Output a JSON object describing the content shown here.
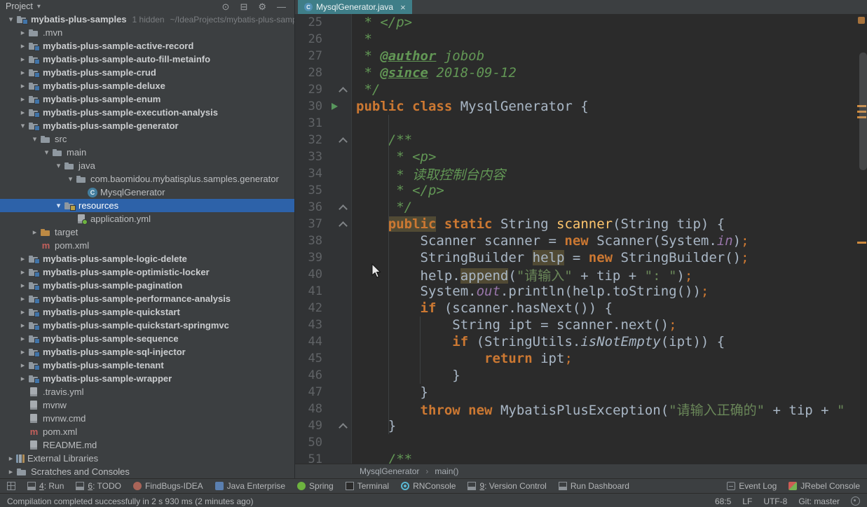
{
  "project_panel": {
    "title": "Project",
    "header_icons": [
      {
        "name": "locate-file-icon",
        "glyph": "⊙"
      },
      {
        "name": "collapse-all-icon",
        "glyph": "⊟"
      },
      {
        "name": "settings-icon",
        "glyph": "⚙"
      },
      {
        "name": "hide-panel-icon",
        "glyph": "—"
      }
    ],
    "tree": [
      {
        "label": "mybatis-plus-samples",
        "level": 0,
        "arrow": "down",
        "icon": "module",
        "bold": true,
        "meta": "1 hidden",
        "path": "~/IdeaProjects/mybatis-plus-samples"
      },
      {
        "label": ".mvn",
        "level": 1,
        "arrow": "right",
        "icon": "folder"
      },
      {
        "label": "mybatis-plus-sample-active-record",
        "level": 1,
        "arrow": "right",
        "icon": "module",
        "bold": true
      },
      {
        "label": "mybatis-plus-sample-auto-fill-metainfo",
        "level": 1,
        "arrow": "right",
        "icon": "module",
        "bold": true
      },
      {
        "label": "mybatis-plus-sample-crud",
        "level": 1,
        "arrow": "right",
        "icon": "module",
        "bold": true
      },
      {
        "label": "mybatis-plus-sample-deluxe",
        "level": 1,
        "arrow": "right",
        "icon": "module",
        "bold": true
      },
      {
        "label": "mybatis-plus-sample-enum",
        "level": 1,
        "arrow": "right",
        "icon": "module",
        "bold": true
      },
      {
        "label": "mybatis-plus-sample-execution-analysis",
        "level": 1,
        "arrow": "right",
        "icon": "module",
        "bold": true
      },
      {
        "label": "mybatis-plus-sample-generator",
        "level": 1,
        "arrow": "down",
        "icon": "module",
        "bold": true
      },
      {
        "label": "src",
        "level": 2,
        "arrow": "down",
        "icon": "folder"
      },
      {
        "label": "main",
        "level": 3,
        "arrow": "down",
        "icon": "folder"
      },
      {
        "label": "java",
        "level": 4,
        "arrow": "down",
        "icon": "folder"
      },
      {
        "label": "com.baomidou.mybatisplus.samples.generator",
        "level": 5,
        "arrow": "down",
        "icon": "package"
      },
      {
        "label": "MysqlGenerator",
        "level": 6,
        "arrow": "none",
        "icon": "class"
      },
      {
        "label": "resources",
        "level": 4,
        "arrow": "down",
        "icon": "resfolder",
        "selected": true
      },
      {
        "label": "application.yml",
        "level": 5,
        "arrow": "none",
        "icon": "yml"
      },
      {
        "label": "target",
        "level": 2,
        "arrow": "right",
        "icon": "folder-orange"
      },
      {
        "label": "pom.xml",
        "level": 2,
        "arrow": "none",
        "icon": "maven"
      },
      {
        "label": "mybatis-plus-sample-logic-delete",
        "level": 1,
        "arrow": "right",
        "icon": "module",
        "bold": true
      },
      {
        "label": "mybatis-plus-sample-optimistic-locker",
        "level": 1,
        "arrow": "right",
        "icon": "module",
        "bold": true
      },
      {
        "label": "mybatis-plus-sample-pagination",
        "level": 1,
        "arrow": "right",
        "icon": "module",
        "bold": true
      },
      {
        "label": "mybatis-plus-sample-performance-analysis",
        "level": 1,
        "arrow": "right",
        "icon": "module",
        "bold": true
      },
      {
        "label": "mybatis-plus-sample-quickstart",
        "level": 1,
        "arrow": "right",
        "icon": "module",
        "bold": true
      },
      {
        "label": "mybatis-plus-sample-quickstart-springmvc",
        "level": 1,
        "arrow": "right",
        "icon": "module",
        "bold": true
      },
      {
        "label": "mybatis-plus-sample-sequence",
        "level": 1,
        "arrow": "right",
        "icon": "module",
        "bold": true
      },
      {
        "label": "mybatis-plus-sample-sql-injector",
        "level": 1,
        "arrow": "right",
        "icon": "module",
        "bold": true
      },
      {
        "label": "mybatis-plus-sample-tenant",
        "level": 1,
        "arrow": "right",
        "icon": "module",
        "bold": true
      },
      {
        "label": "mybatis-plus-sample-wrapper",
        "level": 1,
        "arrow": "right",
        "icon": "module",
        "bold": true
      },
      {
        "label": ".travis.yml",
        "level": 1,
        "arrow": "none",
        "icon": "file"
      },
      {
        "label": "mvnw",
        "level": 1,
        "arrow": "none",
        "icon": "file"
      },
      {
        "label": "mvnw.cmd",
        "level": 1,
        "arrow": "none",
        "icon": "file"
      },
      {
        "label": "pom.xml",
        "level": 1,
        "arrow": "none",
        "icon": "maven"
      },
      {
        "label": "README.md",
        "level": 1,
        "arrow": "none",
        "icon": "file"
      },
      {
        "label": "External Libraries",
        "level": 0,
        "arrow": "right",
        "icon": "lib"
      },
      {
        "label": "Scratches and Consoles",
        "level": 0,
        "arrow": "right",
        "icon": "scratch"
      }
    ]
  },
  "editor": {
    "tab": {
      "title": "MysqlGenerator.java",
      "close_glyph": "×"
    },
    "breadcrumbs": [
      "MysqlGenerator",
      "main()"
    ],
    "code": {
      "lines": [
        {
          "num": 25,
          "tokens": [
            [
              " * </p>",
              "c"
            ]
          ]
        },
        {
          "num": 26,
          "tokens": [
            [
              " *",
              "c"
            ]
          ]
        },
        {
          "num": 27,
          "tokens": [
            [
              " * ",
              "c"
            ],
            [
              "@author",
              "ct"
            ],
            [
              " jobob",
              "ci"
            ]
          ]
        },
        {
          "num": 28,
          "tokens": [
            [
              " * ",
              "c"
            ],
            [
              "@since",
              "ct"
            ],
            [
              " 2018-09-12",
              "ci"
            ]
          ]
        },
        {
          "num": 29,
          "gutter": "fold",
          "tokens": [
            [
              " */",
              "c"
            ]
          ]
        },
        {
          "num": 30,
          "gutter": "run",
          "tokens": [
            [
              "public class ",
              "k"
            ],
            [
              "MysqlGenerator {",
              ""
            ]
          ]
        },
        {
          "num": 31,
          "tokens": []
        },
        {
          "num": 32,
          "gutter": "fold",
          "tokens": [
            [
              "    /**",
              "c"
            ]
          ]
        },
        {
          "num": 33,
          "tokens": [
            [
              "     * <p>",
              "c"
            ]
          ]
        },
        {
          "num": 34,
          "tokens": [
            [
              "     * 读取控制台内容",
              "c"
            ]
          ]
        },
        {
          "num": 35,
          "tokens": [
            [
              "     * </p>",
              "c"
            ]
          ]
        },
        {
          "num": 36,
          "gutter": "fold",
          "tokens": [
            [
              "     */",
              "c"
            ]
          ]
        },
        {
          "num": 37,
          "gutter": "fold",
          "tokens": [
            [
              "    ",
              ""
            ],
            [
              "public",
              "k h"
            ],
            [
              " ",
              ""
            ],
            [
              "static",
              "k"
            ],
            [
              " String ",
              ""
            ],
            [
              "scanner",
              "m"
            ],
            [
              "(String tip) {",
              ""
            ]
          ]
        },
        {
          "num": 38,
          "tokens": [
            [
              "        Scanner scanner = ",
              ""
            ],
            [
              "new",
              "k"
            ],
            [
              " Scanner(System.",
              ""
            ],
            [
              "in",
              "f"
            ],
            [
              ")",
              ""
            ],
            [
              ";",
              "sem"
            ]
          ]
        },
        {
          "num": 39,
          "tokens": [
            [
              "        StringBuilder ",
              ""
            ],
            [
              "help",
              "h"
            ],
            [
              " = ",
              ""
            ],
            [
              "new",
              "k"
            ],
            [
              " StringBuilder()",
              ""
            ],
            [
              ";",
              "sem"
            ]
          ]
        },
        {
          "num": 40,
          "tokens": [
            [
              "        help.",
              ""
            ],
            [
              "append",
              "h"
            ],
            [
              "(",
              ""
            ],
            [
              "\"请输入\"",
              "s"
            ],
            [
              " + tip + ",
              ""
            ],
            [
              "\": \"",
              "s"
            ],
            [
              ")",
              ""
            ],
            [
              ";",
              "sem"
            ]
          ]
        },
        {
          "num": 41,
          "tokens": [
            [
              "        System.",
              ""
            ],
            [
              "out",
              "f"
            ],
            [
              ".println(help.toString())",
              ""
            ],
            [
              ";",
              "sem"
            ]
          ]
        },
        {
          "num": 42,
          "tokens": [
            [
              "        ",
              ""
            ],
            [
              "if",
              "k"
            ],
            [
              " (scanner.hasNext()) {",
              ""
            ]
          ]
        },
        {
          "num": 43,
          "tokens": [
            [
              "            String ipt = scanner.next()",
              ""
            ],
            [
              ";",
              "sem"
            ]
          ]
        },
        {
          "num": 44,
          "tokens": [
            [
              "            ",
              ""
            ],
            [
              "if",
              "k"
            ],
            [
              " (StringUtils.",
              ""
            ],
            [
              "isNotEmpty",
              "it"
            ],
            [
              "(ipt)) {",
              ""
            ]
          ]
        },
        {
          "num": 45,
          "tokens": [
            [
              "                ",
              ""
            ],
            [
              "return",
              "k"
            ],
            [
              " ipt",
              ""
            ],
            [
              ";",
              "sem"
            ]
          ]
        },
        {
          "num": 46,
          "tokens": [
            [
              "            }",
              ""
            ]
          ]
        },
        {
          "num": 47,
          "tokens": [
            [
              "        }",
              ""
            ]
          ]
        },
        {
          "num": 48,
          "tokens": [
            [
              "        ",
              ""
            ],
            [
              "throw",
              "k"
            ],
            [
              " ",
              ""
            ],
            [
              "new",
              "k"
            ],
            [
              " MybatisPlusException(",
              ""
            ],
            [
              "\"请输入正确的\"",
              "s"
            ],
            [
              " + tip + ",
              ""
            ],
            [
              "\"",
              "s"
            ]
          ]
        },
        {
          "num": 49,
          "gutter": "fold",
          "tokens": [
            [
              "    }",
              ""
            ]
          ]
        },
        {
          "num": 50,
          "tokens": []
        },
        {
          "num": 51,
          "tokens": [
            [
              "    /**",
              "c"
            ]
          ]
        }
      ]
    }
  },
  "tool_bar": {
    "left": [
      {
        "name": "toolwindow-switcher-icon",
        "icon": "switcher"
      },
      {
        "name": "toolbar-run",
        "icon": "toolwindow",
        "mnemonic": "4",
        "label": "Run"
      },
      {
        "name": "toolbar-todo",
        "icon": "todo",
        "mnemonic": "6",
        "label": "TODO"
      },
      {
        "name": "toolbar-findbugs",
        "icon": "bug",
        "label": "FindBugs-IDEA"
      },
      {
        "name": "toolbar-java-enterprise",
        "icon": "javaee",
        "label": "Java Enterprise"
      },
      {
        "name": "toolbar-spring",
        "icon": "spring",
        "label": "Spring"
      },
      {
        "name": "toolbar-terminal",
        "icon": "terminal",
        "label": "Terminal"
      },
      {
        "name": "toolbar-rnconsole",
        "icon": "react",
        "label": "RNConsole"
      },
      {
        "name": "toolbar-version-control",
        "icon": "vcs",
        "mnemonic": "9",
        "label": "Version Control"
      },
      {
        "name": "toolbar-run-dashboard",
        "icon": "dashboard",
        "label": "Run Dashboard"
      }
    ],
    "right": [
      {
        "name": "toolbar-event-log",
        "icon": "eventlog",
        "label": "Event Log"
      },
      {
        "name": "toolbar-jrebel-console",
        "icon": "jrebel",
        "label": "JRebel Console"
      }
    ]
  },
  "status_bar": {
    "message": "Compilation completed successfully in 2 s 930 ms (2 minutes ago)",
    "items": [
      {
        "name": "caret-position",
        "text": "68:5"
      },
      {
        "name": "line-separator",
        "text": "LF"
      },
      {
        "name": "encoding",
        "text": "UTF-8"
      },
      {
        "name": "git-branch",
        "text": "Git: master"
      }
    ]
  }
}
